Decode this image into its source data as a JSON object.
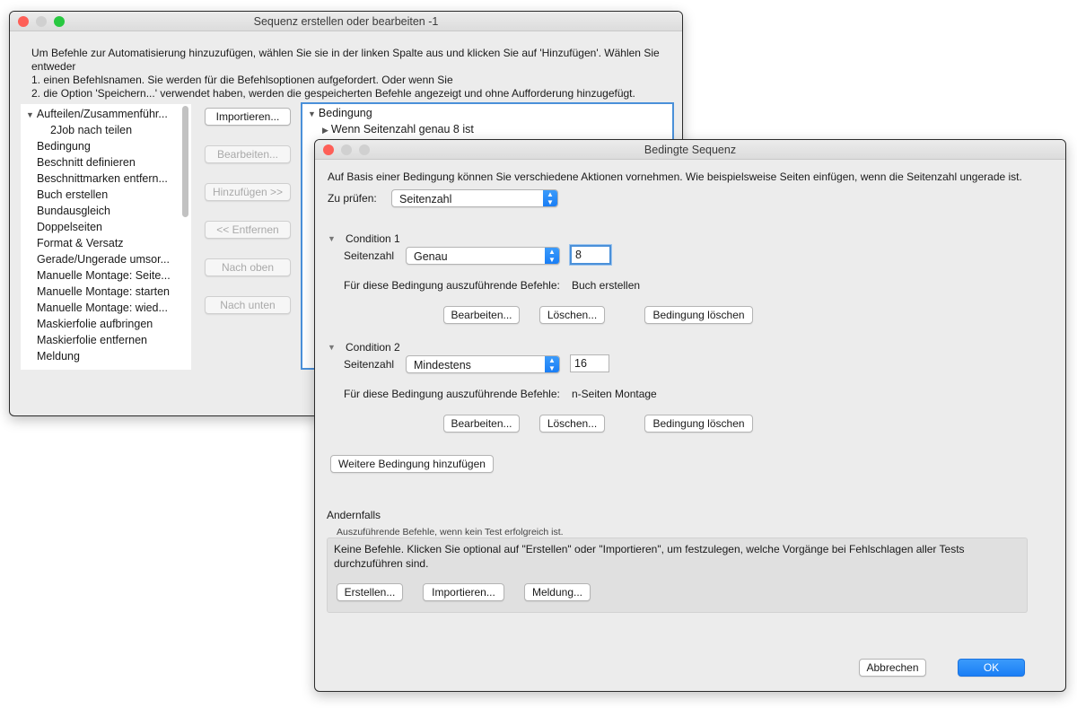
{
  "main_window": {
    "title": "Sequenz erstellen oder bearbeiten -1",
    "instructions": [
      "Um Befehle zur Automatisierung hinzuzufügen, wählen Sie sie in der linken Spalte aus und klicken Sie auf 'Hinzufügen'. Wählen Sie",
      "entweder",
      "1. einen Befehlsnamen. Sie werden für die Befehlsoptionen aufgefordert. Oder wenn Sie",
      "2. die Option 'Speichern...' verwendet haben, werden die gespeicherten Befehle angezeigt und ohne Aufforderung hinzugefügt."
    ],
    "command_list": [
      {
        "label": "Aufteilen/Zusammenführ...",
        "disclosure": "▼"
      },
      {
        "label": "2Job nach teilen"
      },
      {
        "label": "Bedingung"
      },
      {
        "label": "Beschnitt definieren"
      },
      {
        "label": "Beschnittmarken entfern..."
      },
      {
        "label": "Buch erstellen"
      },
      {
        "label": "Bundausgleich"
      },
      {
        "label": "Doppelseiten"
      },
      {
        "label": "Format & Versatz"
      },
      {
        "label": "Gerade/Ungerade umsor..."
      },
      {
        "label": "Manuelle Montage: Seite..."
      },
      {
        "label": "Manuelle Montage: starten"
      },
      {
        "label": "Manuelle Montage: wied..."
      },
      {
        "label": "Maskierfolie aufbringen"
      },
      {
        "label": "Maskierfolie entfernen"
      },
      {
        "label": "Meldung"
      }
    ],
    "buttons": {
      "importieren": "Importieren...",
      "bearbeiten": "Bearbeiten...",
      "hinzufuegen": "Hinzufügen >>",
      "entfernen": "<< Entfernen",
      "nach_oben": "Nach oben",
      "nach_unten": "Nach unten"
    },
    "sequence_tree": [
      {
        "label": "Bedingung",
        "disclosure": "▼"
      },
      {
        "label": "Wenn Seitenzahl genau 8 ist",
        "disclosure": "▶"
      }
    ]
  },
  "dialog": {
    "title": "Bedingte Sequenz",
    "description": "Auf Basis einer Bedingung können Sie verschiedene Aktionen vornehmen. Wie beispielsweise Seiten einfügen, wenn die Seitenzahl ungerade ist.",
    "check_label": "Zu prüfen:",
    "check_value": "Seitenzahl",
    "conditions": [
      {
        "title": "Condition 1",
        "field_label": "Seitenzahl",
        "operator": "Genau",
        "value": "8",
        "commands_label": "Für diese Bedingung auszuführende Befehle:",
        "commands_value": "Buch erstellen",
        "edit_label": "Bearbeiten...",
        "delete_label": "Löschen...",
        "remove_label": "Bedingung löschen"
      },
      {
        "title": "Condition 2",
        "field_label": "Seitenzahl",
        "operator": "Mindestens",
        "value": "16",
        "commands_label": "Für diese Bedingung auszuführende Befehle:",
        "commands_value": "n-Seiten Montage",
        "edit_label": "Bearbeiten...",
        "delete_label": "Löschen...",
        "remove_label": "Bedingung löschen"
      }
    ],
    "add_condition_label": "Weitere Bedingung hinzufügen",
    "otherwise_title": "Andernfalls",
    "otherwise_subtitle": "Auszuführende Befehle, wenn kein Test erfolgreich ist.",
    "otherwise_text_1": "Keine Befehle. Klicken Sie optional auf \"Erstellen\" oder \"Importieren\", um festzulegen, welche Vorgänge bei Fehlschlagen aller Tests",
    "otherwise_text_2": "durchzuführen sind.",
    "otherwise_buttons": {
      "erstellen": "Erstellen...",
      "importieren": "Importieren...",
      "meldung": "Meldung..."
    },
    "cancel_label": "Abbrechen",
    "ok_label": "OK"
  },
  "colors": {
    "close": "#fe5f57",
    "minimize": "#febc2e",
    "zoom": "#28c840",
    "inactive_light": "#d0d0d0",
    "accent": "#1a7ef5",
    "focus_ring": "#4a90d9"
  }
}
